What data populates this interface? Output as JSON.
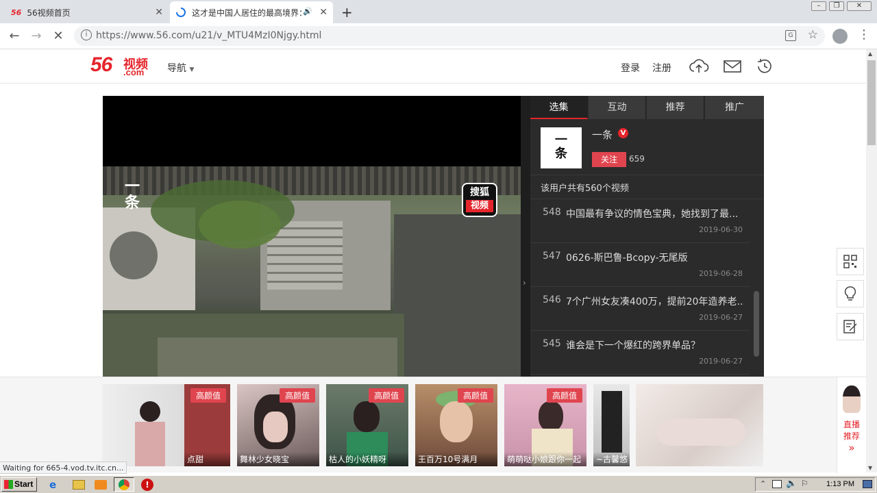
{
  "browser": {
    "tabs": [
      {
        "title": "56视频首页",
        "favicon": "56"
      },
      {
        "title": "这才是中国人居住的最高境界：",
        "favicon": "loading-spinner"
      }
    ],
    "url": "https://www.56.com/u21/v_MTU4MzI0Njgy.html",
    "status_text": "Waiting for 665-4.vod.tv.itc.cn..."
  },
  "site": {
    "logo": {
      "main": "56",
      "cn": "视频",
      "dom": ".com"
    },
    "nav_label": "导航",
    "login": "登录",
    "register": "注册"
  },
  "player": {
    "watermark_cn": "搜狐",
    "watermark_cn2": "视频",
    "channel_mark": "一条"
  },
  "panel": {
    "tabs": [
      "选集",
      "互动",
      "推荐",
      "推广"
    ],
    "uploader": {
      "avatar_text": "一条",
      "name": "一条",
      "follow_label": "关注",
      "followers": "659"
    },
    "total_text": "该用户共有560个视频",
    "videos": [
      {
        "num": "548",
        "title": "中国最有争议的情色宝典，她找到了最...",
        "date": "2019-06-30"
      },
      {
        "num": "547",
        "title": "0626-斯巴鲁-Bcopy-无尾版",
        "date": "2019-06-28"
      },
      {
        "num": "546",
        "title": "7个广州女友凑400万，提前20年造养老...",
        "date": "2019-06-27"
      },
      {
        "num": "545",
        "title": "谁会是下一个爆红的跨界单品？",
        "date": "2019-06-27"
      }
    ]
  },
  "strip": {
    "badge": "高颜值",
    "items": [
      {
        "caption": "点甜",
        "badge": true
      },
      {
        "caption": "舞林少女晓宝",
        "badge": true
      },
      {
        "caption": "枯人的小妖精呀",
        "badge": true
      },
      {
        "caption": "王百万10号满月",
        "badge": true
      },
      {
        "caption": "萌萌哒小娘跟你一起",
        "badge": true
      },
      {
        "caption": "~古馨悠",
        "badge": false
      }
    ],
    "live_label1": "直播",
    "live_label2": "推荐"
  },
  "taskbar": {
    "start": "Start",
    "clock": "1:13 PM"
  },
  "icons": {
    "accent": "#e5252c",
    "badge_color": "#e0454f"
  }
}
